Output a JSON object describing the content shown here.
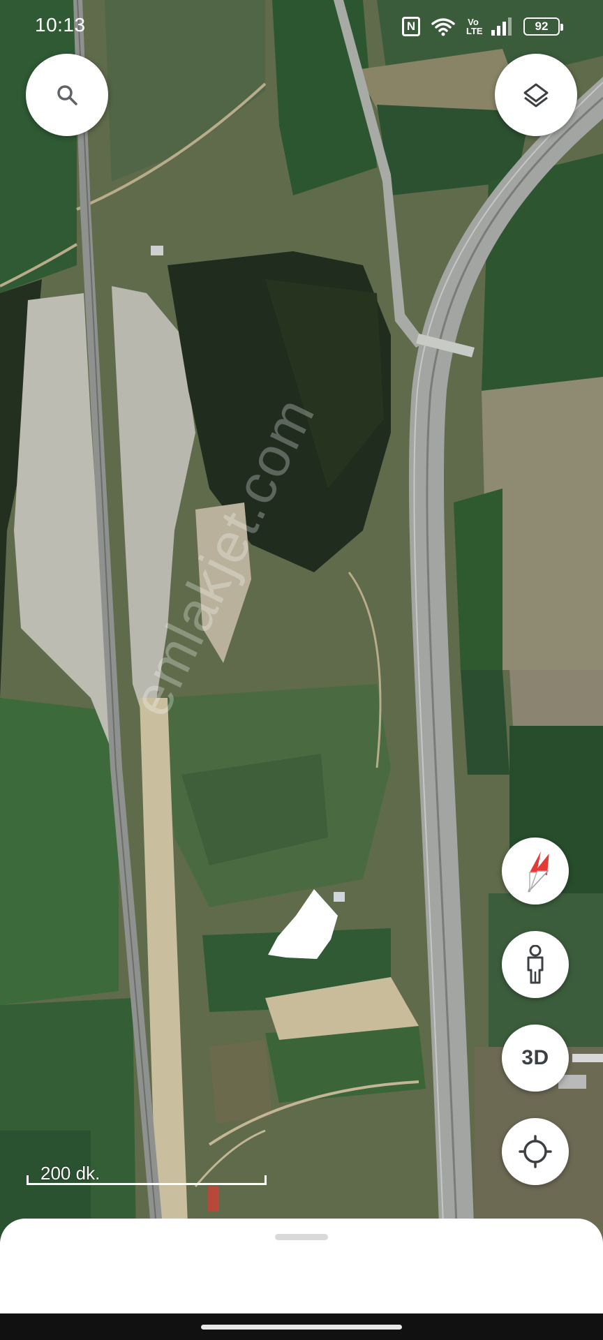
{
  "status_bar": {
    "time": "10:13",
    "nfc_label": "N",
    "volte_label": "Vo\nLTE",
    "battery": "92"
  },
  "map": {
    "type": "satellite",
    "watermark": "emlakjet.com",
    "scale_label": "200 dk."
  },
  "controls": {
    "search_icon": "search-icon",
    "layers_icon": "layers-icon",
    "compass_icon": "compass-icon",
    "street_view_icon": "pegman-icon",
    "three_d_label": "3D",
    "locate_icon": "crosshair-icon"
  },
  "colors": {
    "parcel": "#ffffff",
    "button_bg": "#ffffff",
    "compass_red": "#e53935",
    "icon_gray": "#5f6368"
  }
}
